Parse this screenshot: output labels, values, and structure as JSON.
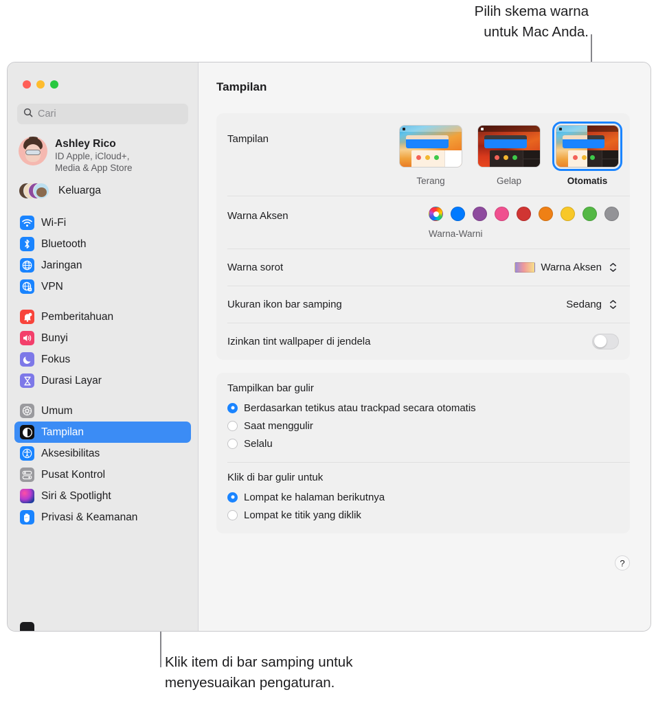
{
  "callouts": {
    "top": "Pilih skema warna\nuntuk Mac Anda.",
    "bottom": "Klik item di bar samping untuk\nmenyesuaikan pengaturan."
  },
  "window": {
    "title": "Tampilan"
  },
  "sidebar": {
    "search": {
      "placeholder": "Cari",
      "icon": "search-icon"
    },
    "account": {
      "name": "Ashley Rico",
      "subtitle_line1": "ID Apple, iCloud+,",
      "subtitle_line2": "Media & App Store"
    },
    "family": {
      "label": "Keluarga"
    },
    "groups": [
      {
        "items": [
          {
            "label": "Wi-Fi",
            "icon": "wifi-icon"
          },
          {
            "label": "Bluetooth",
            "icon": "bluetooth-icon"
          },
          {
            "label": "Jaringan",
            "icon": "globe-icon"
          },
          {
            "label": "VPN",
            "icon": "vpn-icon"
          }
        ]
      },
      {
        "items": [
          {
            "label": "Pemberitahuan",
            "icon": "bell-icon"
          },
          {
            "label": "Bunyi",
            "icon": "speaker-icon"
          },
          {
            "label": "Fokus",
            "icon": "moon-icon"
          },
          {
            "label": "Durasi Layar",
            "icon": "hourglass-icon"
          }
        ]
      },
      {
        "items": [
          {
            "label": "Umum",
            "icon": "gear-icon"
          },
          {
            "label": "Tampilan",
            "icon": "appearance-icon",
            "selected": true
          },
          {
            "label": "Aksesibilitas",
            "icon": "accessibility-icon"
          },
          {
            "label": "Pusat Kontrol",
            "icon": "control-center-icon"
          },
          {
            "label": "Siri & Spotlight",
            "icon": "siri-icon"
          },
          {
            "label": "Privasi & Keamanan",
            "icon": "hand-icon"
          }
        ]
      }
    ]
  },
  "main": {
    "appearance": {
      "label": "Tampilan",
      "options": [
        {
          "label": "Terang",
          "selected": false
        },
        {
          "label": "Gelap",
          "selected": false
        },
        {
          "label": "Otomatis",
          "selected": true
        }
      ]
    },
    "accent": {
      "label": "Warna Aksen",
      "caption": "Warna-Warni",
      "colors": [
        {
          "name": "multicolor",
          "hex": "multicolor",
          "selected": true
        },
        {
          "name": "blue",
          "hex": "#007AFF"
        },
        {
          "name": "purple",
          "hex": "#8E4B9E"
        },
        {
          "name": "pink",
          "hex": "#F0508F"
        },
        {
          "name": "red",
          "hex": "#D03533"
        },
        {
          "name": "orange",
          "hex": "#EF8015"
        },
        {
          "name": "yellow",
          "hex": "#F8C828"
        },
        {
          "name": "green",
          "hex": "#54B845"
        },
        {
          "name": "graphite",
          "hex": "#939397"
        }
      ]
    },
    "highlight": {
      "label": "Warna sorot",
      "value": "Warna Aksen"
    },
    "sidebar_icon_size": {
      "label": "Ukuran ikon bar samping",
      "value": "Sedang"
    },
    "wallpaper_tint": {
      "label": "Izinkan tint wallpaper di jendela",
      "on": false
    },
    "scrollbar_show": {
      "title": "Tampilkan bar gulir",
      "options": [
        {
          "label": "Berdasarkan tetikus atau trackpad secara otomatis",
          "selected": true
        },
        {
          "label": "Saat menggulir",
          "selected": false
        },
        {
          "label": "Selalu",
          "selected": false
        }
      ]
    },
    "scrollbar_click": {
      "title": "Klik di bar gulir untuk",
      "options": [
        {
          "label": "Lompat ke halaman berikutnya",
          "selected": true
        },
        {
          "label": "Lompat ke titik yang diklik",
          "selected": false
        }
      ]
    },
    "help": {
      "label": "?"
    }
  },
  "colors": {
    "accent_blue": "#1a84ff",
    "selection_blue": "#3b8cf5",
    "window_bg": "#f5f5f5",
    "sidebar_bg": "#e9e9e9",
    "card_bg": "#f0f0f0"
  }
}
